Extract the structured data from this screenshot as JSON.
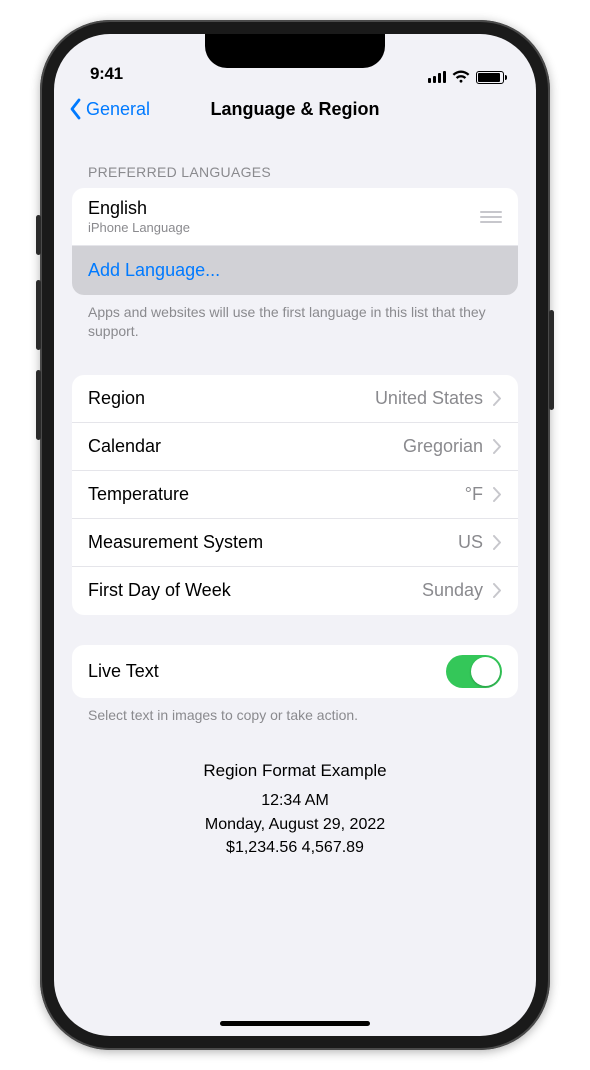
{
  "status": {
    "time": "9:41"
  },
  "nav": {
    "back_label": "General",
    "title": "Language & Region"
  },
  "languages": {
    "header": "PREFERRED LANGUAGES",
    "primary_name": "English",
    "primary_sub": "iPhone Language",
    "add_label": "Add Language...",
    "footer": "Apps and websites will use the first language in this list that they support."
  },
  "settings": {
    "items": [
      {
        "label": "Region",
        "value": "United States"
      },
      {
        "label": "Calendar",
        "value": "Gregorian"
      },
      {
        "label": "Temperature",
        "value": "°F"
      },
      {
        "label": "Measurement System",
        "value": "US"
      },
      {
        "label": "First Day of Week",
        "value": "Sunday"
      }
    ]
  },
  "livetext": {
    "label": "Live Text",
    "on": true,
    "footer": "Select text in images to copy or take action."
  },
  "example": {
    "title": "Region Format Example",
    "time": "12:34 AM",
    "date": "Monday, August 29, 2022",
    "numbers": "$1,234.56   4,567.89"
  }
}
